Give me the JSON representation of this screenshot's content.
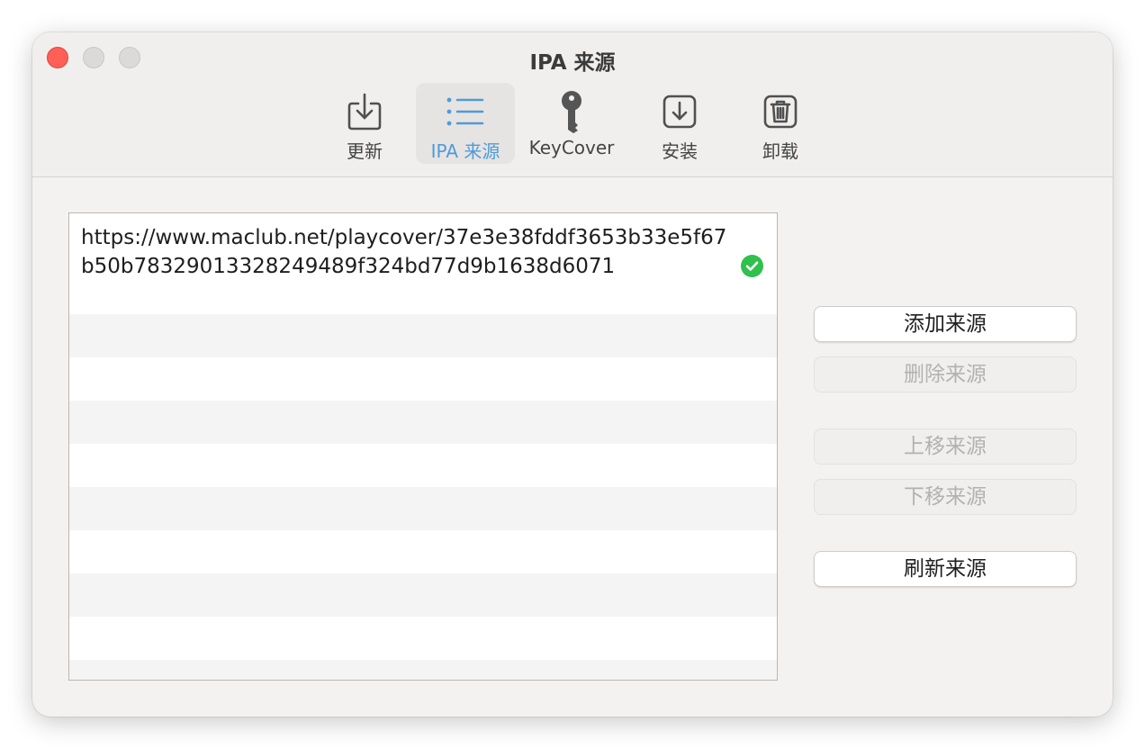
{
  "window": {
    "title": "IPA 来源"
  },
  "toolbar": {
    "items": [
      {
        "label": "更新",
        "icon": "update-download-icon",
        "selected": false
      },
      {
        "label": "IPA 来源",
        "icon": "list-icon",
        "selected": true
      },
      {
        "label": "KeyCover",
        "icon": "key-icon",
        "selected": false
      },
      {
        "label": "安装",
        "icon": "install-arrow-icon",
        "selected": false
      },
      {
        "label": "卸载",
        "icon": "trash-icon",
        "selected": false
      }
    ]
  },
  "sources": {
    "rows": [
      {
        "url": "https://www.maclub.net/playcover/37e3e38fddf3653b33e5f67b50b78329013328249489f324bd77d9b1638d6071",
        "status": "valid",
        "status_icon": "checkmark-circle-icon",
        "status_color": "#30c04c"
      }
    ]
  },
  "actions": {
    "add_label": "添加来源",
    "delete_label": "删除来源",
    "move_up_label": "上移来源",
    "move_down_label": "下移来源",
    "refresh_label": "刷新来源"
  },
  "colors": {
    "accent": "#4f9bd9",
    "close_button": "#fe5f57"
  }
}
